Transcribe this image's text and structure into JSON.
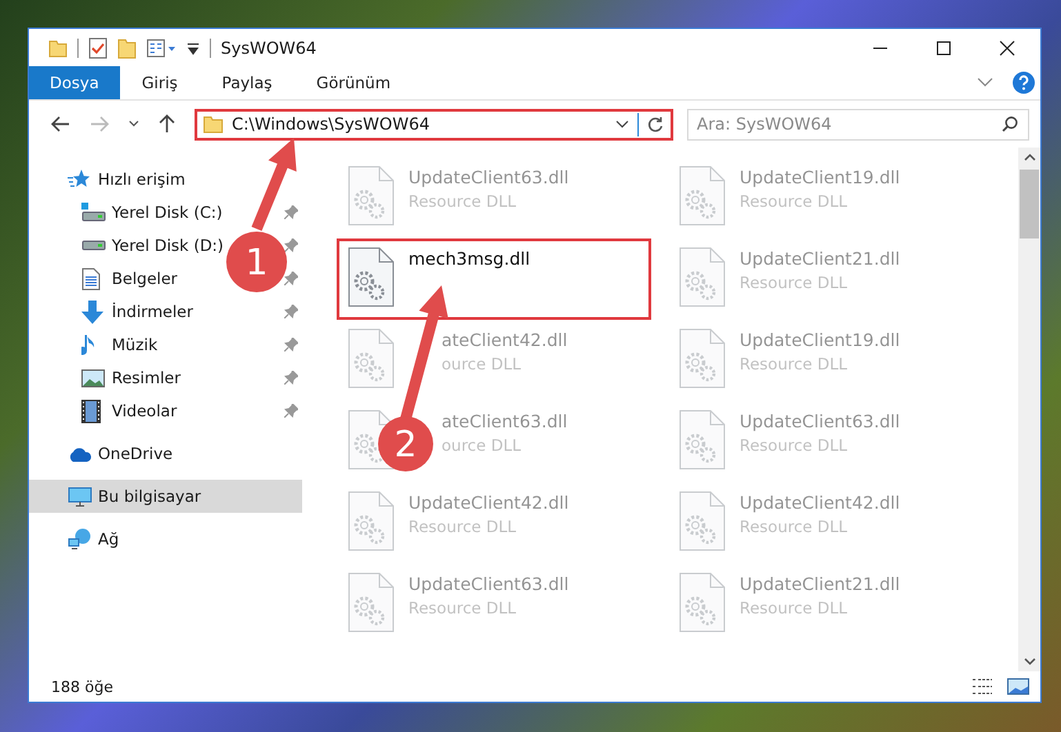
{
  "window": {
    "title": "SysWOW64"
  },
  "ribbon_tabs": [
    {
      "label": "Dosya",
      "selected": true
    },
    {
      "label": "Giriş",
      "selected": false
    },
    {
      "label": "Paylaş",
      "selected": false
    },
    {
      "label": "Görünüm",
      "selected": false
    }
  ],
  "address_bar": {
    "path": "C:\\Windows\\SysWOW64",
    "highlighted": true
  },
  "search": {
    "placeholder": "Ara: SysWOW64"
  },
  "nav_items": [
    {
      "label": "Hızlı erişim",
      "kind": "star",
      "selected": false,
      "children": [
        {
          "label": "Yerel Disk (C:)",
          "kind": "drive-c",
          "pinned": true,
          "selected": false
        },
        {
          "label": "Yerel Disk (D:)",
          "kind": "drive",
          "pinned": true,
          "selected": false
        },
        {
          "label": "Belgeler",
          "kind": "document",
          "pinned": true,
          "selected": false
        },
        {
          "label": "İndirmeler",
          "kind": "download",
          "pinned": true,
          "selected": false
        },
        {
          "label": "Müzik",
          "kind": "music",
          "pinned": true,
          "selected": false
        },
        {
          "label": "Resimler",
          "kind": "picture",
          "pinned": true,
          "selected": false
        },
        {
          "label": "Videolar",
          "kind": "video",
          "pinned": true,
          "selected": false
        }
      ]
    },
    {
      "label": "OneDrive",
      "kind": "cloud",
      "selected": false
    },
    {
      "label": "Bu bilgisayar",
      "kind": "computer",
      "selected": true
    },
    {
      "label": "Ağ",
      "kind": "network",
      "selected": false
    }
  ],
  "files": [
    {
      "name": "UpdateClient63.dll",
      "type": "Resource DLL",
      "blurred": true,
      "highlighted": false
    },
    {
      "name": "UpdateClient19.dll",
      "type": "Resource DLL",
      "blurred": true,
      "highlighted": false
    },
    {
      "name": "mech3msg.dll",
      "blurred": false,
      "highlighted": true
    },
    {
      "name": "UpdateClient21.dll",
      "type": "Resource DLL",
      "blurred": true,
      "highlighted": false
    },
    {
      "name": "ateClient42.dll",
      "type": "ource DLL",
      "blurred": true,
      "highlighted": false,
      "covered": true
    },
    {
      "name": "UpdateClient19.dll",
      "type": "Resource DLL",
      "blurred": true,
      "highlighted": false
    },
    {
      "name": "ateClient63.dll",
      "type": "ource DLL",
      "blurred": true,
      "highlighted": false,
      "covered": true
    },
    {
      "name": "UpdateClient63.dll",
      "type": "Resource DLL",
      "blurred": true,
      "highlighted": false
    },
    {
      "name": "UpdateClient42.dll",
      "type": "Resource DLL",
      "blurred": true,
      "highlighted": false
    },
    {
      "name": "UpdateClient42.dll",
      "type": "Resource DLL",
      "blurred": true,
      "highlighted": false
    },
    {
      "name": "UpdateClient63.dll",
      "type": "Resource DLL",
      "blurred": true,
      "highlighted": false
    },
    {
      "name": "UpdateClient21.dll",
      "type": "Resource DLL",
      "blurred": true,
      "highlighted": false
    }
  ],
  "status_bar": {
    "item_count": "188 öğe"
  },
  "annotations": [
    {
      "label": "1"
    },
    {
      "label": "2"
    }
  ]
}
